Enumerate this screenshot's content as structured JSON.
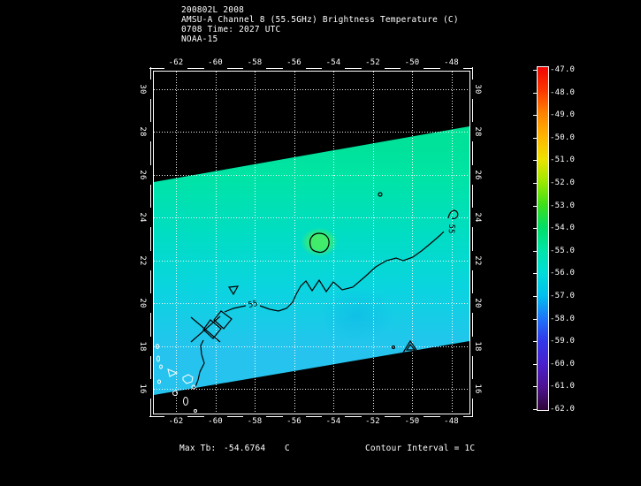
{
  "title_block": {
    "id_line": "200802L 2008",
    "product_line": "AMSU-A Channel 8 (55.5GHz) Brightness Temperature (C)",
    "time_line": "0708 Time: 2027 UTC",
    "satellite_line": "NOAA-15"
  },
  "annotations": {
    "max_tb_label": "Max Tb:",
    "max_tb_value": "-54.6764",
    "max_tb_unit": "C",
    "contour_interval": "Contour Interval = 1C"
  },
  "contours": {
    "labels": [
      "55",
      "55"
    ]
  },
  "chart_data": {
    "type": "heatmap",
    "title": "AMSU-A Channel 8 (55.5GHz) Brightness Temperature (C)",
    "subtitle_lines": [
      "200802L 2008",
      "0708 Time: 2027 UTC",
      "NOAA-15"
    ],
    "x_axis": {
      "tick_labels": [
        "-62",
        "-60",
        "-58",
        "-56",
        "-54",
        "-52",
        "-50",
        "-48"
      ],
      "shown_top_and_bottom": true
    },
    "y_axis": {
      "tick_labels": [
        "30",
        "28",
        "26",
        "24",
        "22",
        "20",
        "18",
        "16"
      ],
      "shown_left_and_right": true,
      "labels_rotated": true
    },
    "grid": "dotted-white",
    "no_data_color": "#000000",
    "swath_description": "valid-data diagonal band rising left-to-right; top edge lat ~25.8 at lon -63 to ~28 at lon -47; bottom edge lat ~15.5 to ~17.5; black = no data",
    "swath_colors": {
      "top": "#00e194",
      "upper": "#00e4a4",
      "mid": "#00ddc4",
      "lower": "#0bd4e0",
      "bottom": "#26c3ee",
      "hotspot": "#48ee60"
    },
    "colorbar": {
      "position": "right",
      "ticks": [
        -47.0,
        -48.0,
        -49.0,
        -50.0,
        -51.0,
        -52.0,
        -53.0,
        -54.0,
        -55.0,
        -56.0,
        -57.0,
        -58.0,
        -59.0,
        -60.0,
        -61.0,
        -62.0
      ],
      "tick_labels": [
        "-47.0",
        "-48.0",
        "-49.0",
        "-50.0",
        "-51.0",
        "-52.0",
        "-53.0",
        "-54.0",
        "-55.0",
        "-56.0",
        "-57.0",
        "-58.0",
        "-59.0",
        "-60.0",
        "-61.0",
        "-62.0"
      ],
      "colors_top_to_bottom": [
        "#f20400",
        "#fb3600",
        "#fd8100",
        "#ffb300",
        "#eee200",
        "#9ee900",
        "#3fdf18",
        "#00de66",
        "#00e5a8",
        "#00dcd8",
        "#00bfee",
        "#1e74f8",
        "#3236ea",
        "#4a20cc",
        "#4e1290",
        "#2d0636"
      ]
    },
    "max_tb_c": -54.6764,
    "contour_interval_c": 1,
    "contour_level_labels": [
      "55",
      "55"
    ]
  }
}
